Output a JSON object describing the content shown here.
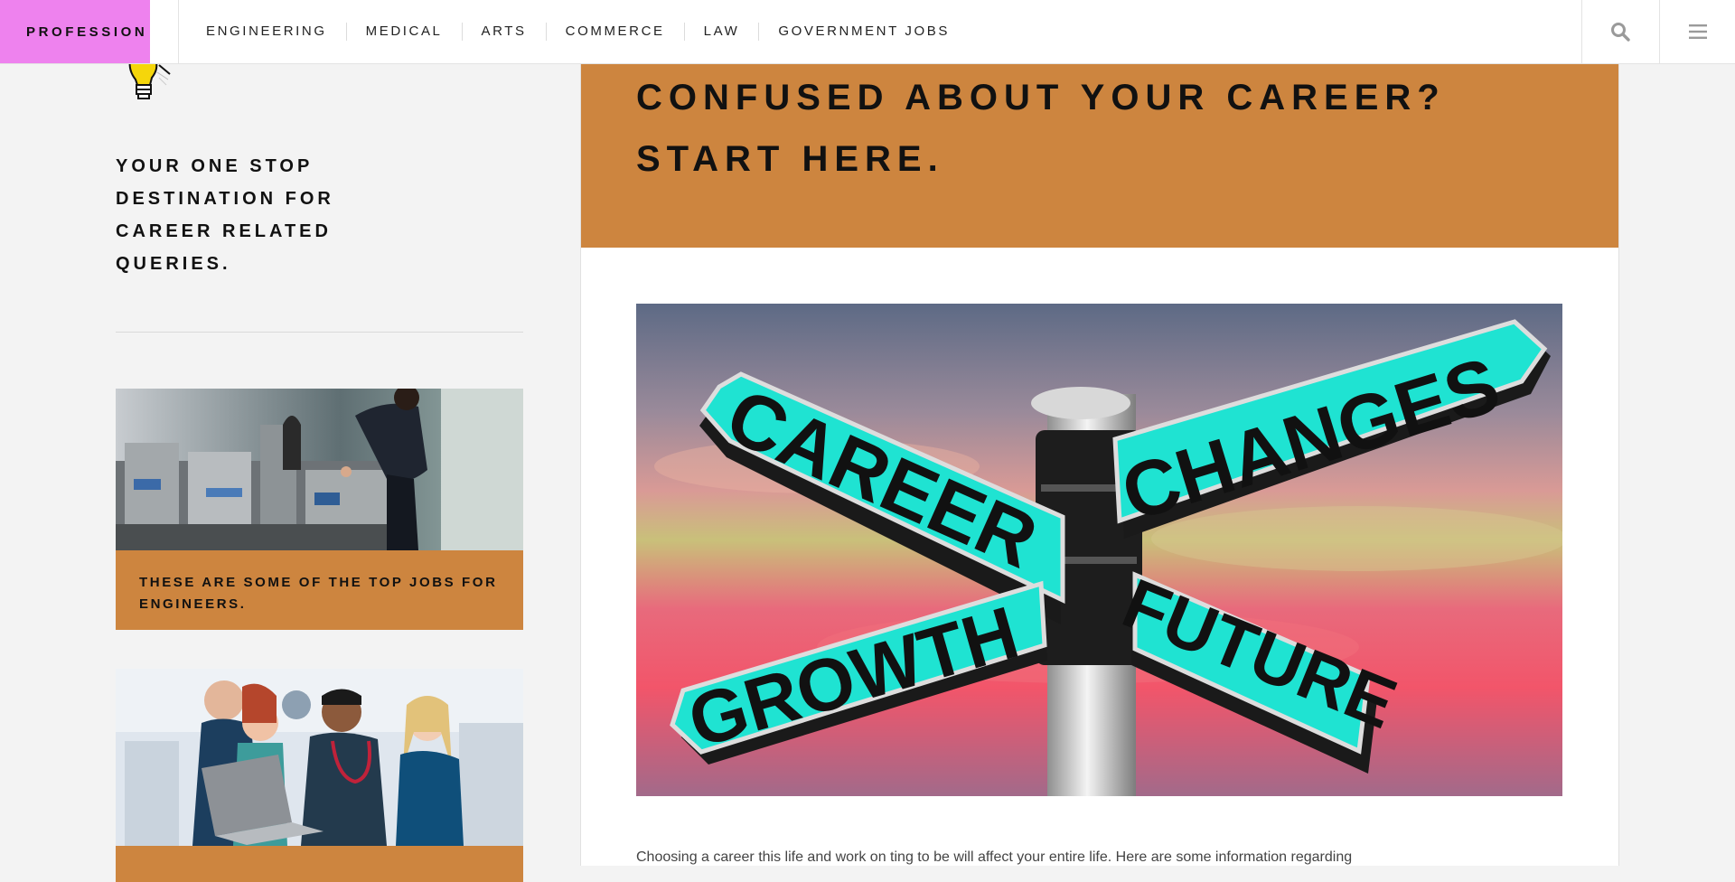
{
  "brand": {
    "name": "PROFESSION"
  },
  "nav": {
    "items": [
      {
        "label": "ENGINEERING"
      },
      {
        "label": "MEDICAL"
      },
      {
        "label": "ARTS"
      },
      {
        "label": "COMMERCE"
      },
      {
        "label": "LAW"
      },
      {
        "label": "GOVERNMENT JOBS"
      }
    ],
    "icons": [
      "search-icon",
      "menu-icon"
    ]
  },
  "sidebar": {
    "logo_icon": "lightbulb-icon",
    "tagline": "YOUR ONE STOP DESTINATION FOR CAREER RELATED QUERIES.",
    "cards": [
      {
        "caption": "THESE ARE SOME OF THE TOP JOBS FOR ENGINEERS.",
        "image": "engineer at industrial machine"
      },
      {
        "caption": "",
        "image": "medical team looking at laptop"
      }
    ]
  },
  "main": {
    "hero_title": "CONFUSED ABOUT YOUR CAREER? START HERE.",
    "signpost": {
      "labels": [
        "CAREER",
        "CHANGES",
        "GROWTH",
        "FUTURE"
      ]
    },
    "excerpt": "Choosing a career this life and work on ting to be will affect your entire life. Here are some information regarding"
  },
  "colors": {
    "brand_pink": "#ee82ee",
    "accent_orange": "#cd853f",
    "sign_cyan": "#19e3d2"
  }
}
